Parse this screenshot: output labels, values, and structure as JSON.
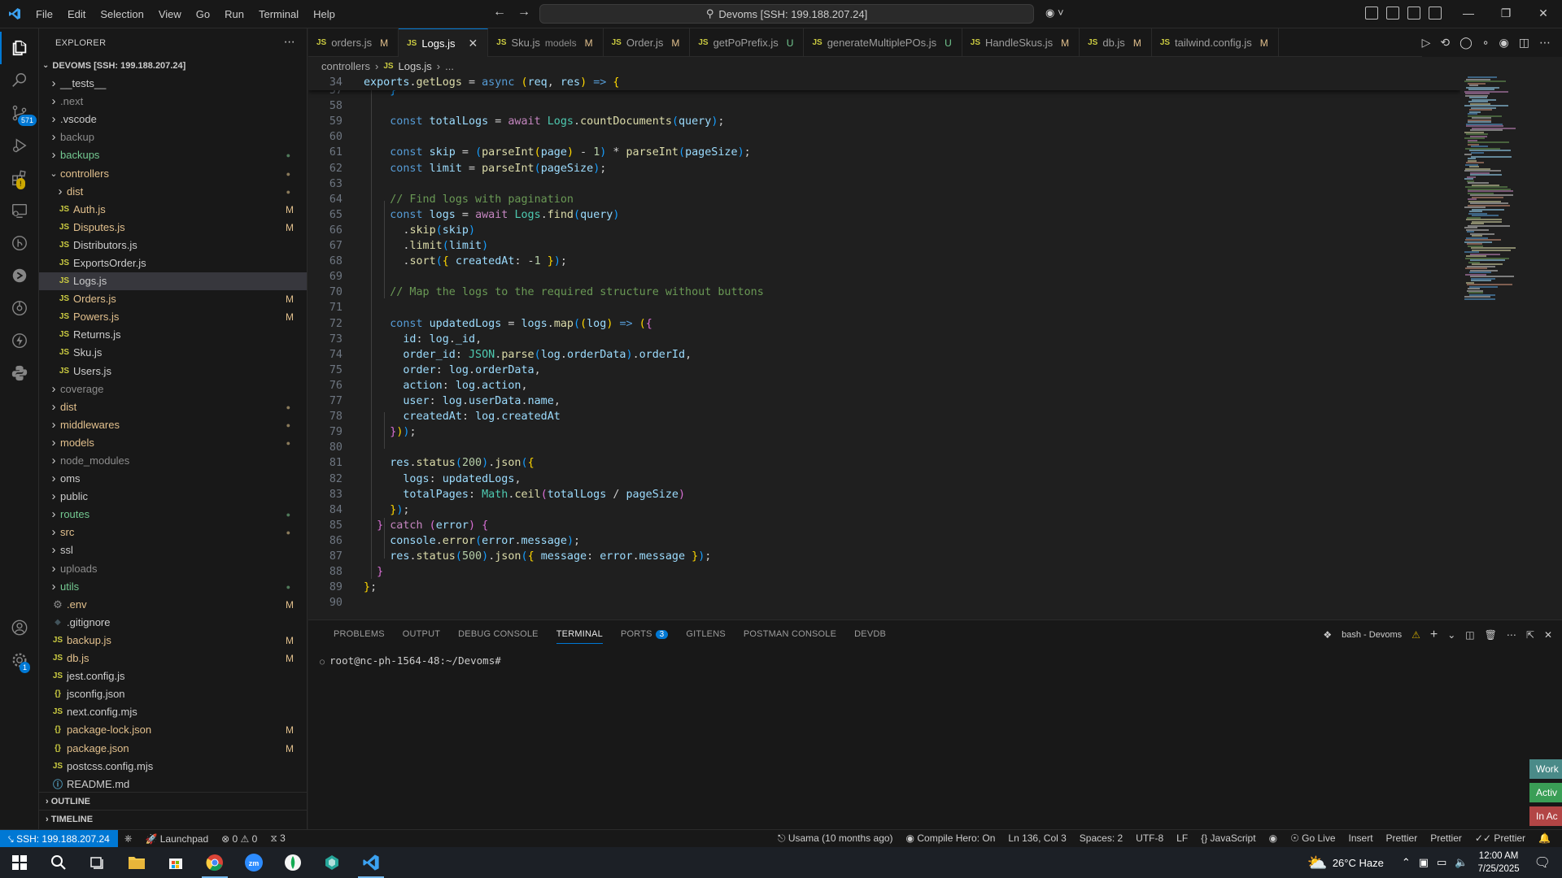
{
  "titlebar": {
    "menu": [
      "File",
      "Edit",
      "Selection",
      "View",
      "Go",
      "Run",
      "Terminal",
      "Help"
    ],
    "search_text": "Devoms [SSH: 199.188.207.24]"
  },
  "activity": {
    "scm_badge": "571"
  },
  "explorer": {
    "title": "EXPLORER",
    "root_label": "DEVOMS [SSH: 199.188.207.24]",
    "items": [
      {
        "label": "__tests__",
        "kind": "folder",
        "indent": 0,
        "open": false,
        "style": "",
        "status": ""
      },
      {
        "label": ".next",
        "kind": "folder",
        "indent": 0,
        "open": false,
        "style": "dim",
        "status": ""
      },
      {
        "label": ".vscode",
        "kind": "folder",
        "indent": 0,
        "open": false,
        "style": "",
        "status": ""
      },
      {
        "label": "backup",
        "kind": "folder",
        "indent": 0,
        "open": false,
        "style": "dim",
        "status": ""
      },
      {
        "label": "backups",
        "kind": "folder",
        "indent": 0,
        "open": false,
        "style": "green",
        "status": "dot-green"
      },
      {
        "label": "controllers",
        "kind": "folder",
        "indent": 0,
        "open": true,
        "style": "mod",
        "status": "dot"
      },
      {
        "label": "dist",
        "kind": "folder",
        "indent": 1,
        "open": false,
        "style": "mod",
        "status": "dot"
      },
      {
        "label": "Auth.js",
        "kind": "js",
        "indent": 1,
        "style": "mod",
        "status": "M"
      },
      {
        "label": "Disputes.js",
        "kind": "js",
        "indent": 1,
        "style": "mod",
        "status": "M"
      },
      {
        "label": "Distributors.js",
        "kind": "js",
        "indent": 1,
        "style": "",
        "status": ""
      },
      {
        "label": "ExportsOrder.js",
        "kind": "js",
        "indent": 1,
        "style": "",
        "status": ""
      },
      {
        "label": "Logs.js",
        "kind": "js",
        "indent": 1,
        "style": "",
        "status": "",
        "selected": true
      },
      {
        "label": "Orders.js",
        "kind": "js",
        "indent": 1,
        "style": "mod",
        "status": "M"
      },
      {
        "label": "Powers.js",
        "kind": "js",
        "indent": 1,
        "style": "mod",
        "status": "M"
      },
      {
        "label": "Returns.js",
        "kind": "js",
        "indent": 1,
        "style": "",
        "status": ""
      },
      {
        "label": "Sku.js",
        "kind": "js",
        "indent": 1,
        "style": "",
        "status": ""
      },
      {
        "label": "Users.js",
        "kind": "js",
        "indent": 1,
        "style": "",
        "status": ""
      },
      {
        "label": "coverage",
        "kind": "folder",
        "indent": 0,
        "open": false,
        "style": "dim",
        "status": ""
      },
      {
        "label": "dist",
        "kind": "folder",
        "indent": 0,
        "open": false,
        "style": "mod",
        "status": "dot"
      },
      {
        "label": "middlewares",
        "kind": "folder",
        "indent": 0,
        "open": false,
        "style": "mod",
        "status": "dot"
      },
      {
        "label": "models",
        "kind": "folder",
        "indent": 0,
        "open": false,
        "style": "mod",
        "status": "dot"
      },
      {
        "label": "node_modules",
        "kind": "folder",
        "indent": 0,
        "open": false,
        "style": "dim",
        "status": ""
      },
      {
        "label": "oms",
        "kind": "folder",
        "indent": 0,
        "open": false,
        "style": "",
        "status": ""
      },
      {
        "label": "public",
        "kind": "folder",
        "indent": 0,
        "open": false,
        "style": "",
        "status": ""
      },
      {
        "label": "routes",
        "kind": "folder",
        "indent": 0,
        "open": false,
        "style": "green",
        "status": "dot-green"
      },
      {
        "label": "src",
        "kind": "folder",
        "indent": 0,
        "open": false,
        "style": "mod",
        "status": "dot"
      },
      {
        "label": "ssl",
        "kind": "folder",
        "indent": 0,
        "open": false,
        "style": "",
        "status": ""
      },
      {
        "label": "uploads",
        "kind": "folder",
        "indent": 0,
        "open": false,
        "style": "dim",
        "status": ""
      },
      {
        "label": "utils",
        "kind": "folder",
        "indent": 0,
        "open": false,
        "style": "green",
        "status": "dot-green"
      },
      {
        "label": ".env",
        "kind": "gear",
        "indent": 0,
        "style": "mod",
        "status": "M"
      },
      {
        "label": ".gitignore",
        "kind": "git",
        "indent": 0,
        "style": "",
        "status": ""
      },
      {
        "label": "backup.js",
        "kind": "js",
        "indent": 0,
        "style": "mod",
        "status": "M"
      },
      {
        "label": "db.js",
        "kind": "js",
        "indent": 0,
        "style": "mod",
        "status": "M"
      },
      {
        "label": "jest.config.js",
        "kind": "js",
        "indent": 0,
        "style": "",
        "status": ""
      },
      {
        "label": "jsconfig.json",
        "kind": "json",
        "indent": 0,
        "style": "",
        "status": ""
      },
      {
        "label": "next.config.mjs",
        "kind": "js",
        "indent": 0,
        "style": "",
        "status": ""
      },
      {
        "label": "package-lock.json",
        "kind": "json",
        "indent": 0,
        "style": "mod",
        "status": "M"
      },
      {
        "label": "package.json",
        "kind": "json",
        "indent": 0,
        "style": "mod",
        "status": "M"
      },
      {
        "label": "postcss.config.mjs",
        "kind": "js",
        "indent": 0,
        "style": "",
        "status": ""
      },
      {
        "label": "README.md",
        "kind": "info",
        "indent": 0,
        "style": "",
        "status": ""
      }
    ],
    "outline_label": "OUTLINE",
    "timeline_label": "TIMELINE"
  },
  "tabs": [
    {
      "label": "orders.js",
      "desc": "",
      "status": "M",
      "active": false
    },
    {
      "label": "Logs.js",
      "desc": "",
      "status": "",
      "active": true
    },
    {
      "label": "Sku.js",
      "desc": "models",
      "status": "M",
      "active": false
    },
    {
      "label": "Order.js",
      "desc": "",
      "status": "M",
      "active": false
    },
    {
      "label": "getPoPrefix.js",
      "desc": "",
      "status": "U",
      "active": false
    },
    {
      "label": "generateMultiplePOs.js",
      "desc": "",
      "status": "U",
      "active": false
    },
    {
      "label": "HandleSkus.js",
      "desc": "",
      "status": "M",
      "active": false
    },
    {
      "label": "db.js",
      "desc": "",
      "status": "M",
      "active": false
    },
    {
      "label": "tailwind.config.js",
      "desc": "",
      "status": "M",
      "active": false
    }
  ],
  "breadcrumb": [
    "controllers",
    "Logs.js",
    "..."
  ],
  "editor": {
    "sticky": {
      "ln": "34",
      "html": "<span class='var'>exports</span>.<span class='fn'>getLogs</span> = <span class='kw'>async</span> <span class='br1'>(</span><span class='var'>req</span>, <span class='var'>res</span><span class='br1'>)</span> <span class='kw'>=&gt;</span> <span class='br1'>{</span>"
    },
    "lines": [
      {
        "ln": "57",
        "html": "    <span class='br3'>}</span>"
      },
      {
        "ln": "58",
        "html": ""
      },
      {
        "ln": "59",
        "html": "    <span class='kw'>const</span> <span class='var'>totalLogs</span> = <span class='kw2'>await</span> <span class='cls'>Logs</span>.<span class='fn'>countDocuments</span><span class='br3'>(</span><span class='var'>query</span><span class='br3'>)</span>;"
      },
      {
        "ln": "60",
        "html": ""
      },
      {
        "ln": "61",
        "html": "    <span class='kw'>const</span> <span class='var'>skip</span> = <span class='br3'>(</span><span class='fn'>parseInt</span><span class='br1'>(</span><span class='var'>page</span><span class='br1'>)</span> - <span class='num'>1</span><span class='br3'>)</span> * <span class='fn'>parseInt</span><span class='br3'>(</span><span class='var'>pageSize</span><span class='br3'>)</span>;"
      },
      {
        "ln": "62",
        "html": "    <span class='kw'>const</span> <span class='var'>limit</span> = <span class='fn'>parseInt</span><span class='br3'>(</span><span class='var'>pageSize</span><span class='br3'>)</span>;"
      },
      {
        "ln": "63",
        "html": ""
      },
      {
        "ln": "64",
        "html": "    <span class='cm'>// Find logs with pagination</span>"
      },
      {
        "ln": "65",
        "html": "    <span class='kw'>const</span> <span class='var'>logs</span> = <span class='kw2'>await</span> <span class='cls'>Logs</span>.<span class='fn'>find</span><span class='br3'>(</span><span class='var'>query</span><span class='br3'>)</span>"
      },
      {
        "ln": "66",
        "html": "      .<span class='fn'>skip</span><span class='br3'>(</span><span class='var'>skip</span><span class='br3'>)</span>"
      },
      {
        "ln": "67",
        "html": "      .<span class='fn'>limit</span><span class='br3'>(</span><span class='var'>limit</span><span class='br3'>)</span>"
      },
      {
        "ln": "68",
        "html": "      .<span class='fn'>sort</span><span class='br3'>(</span><span class='br1'>{</span> <span class='var'>createdAt</span>: -<span class='num'>1</span> <span class='br1'>}</span><span class='br3'>)</span>;"
      },
      {
        "ln": "69",
        "html": ""
      },
      {
        "ln": "70",
        "html": "    <span class='cm'>// Map the logs to the required structure without buttons</span>"
      },
      {
        "ln": "71",
        "html": ""
      },
      {
        "ln": "72",
        "html": "    <span class='kw'>const</span> <span class='var'>updatedLogs</span> = <span class='var'>logs</span>.<span class='fn'>map</span><span class='br3'>(</span><span class='br1'>(</span><span class='var'>log</span><span class='br1'>)</span> <span class='kw'>=&gt;</span> <span class='br1'>(</span><span class='br2'>{</span>"
      },
      {
        "ln": "73",
        "html": "      <span class='var'>id</span>: <span class='var'>log</span>.<span class='var'>_id</span>,"
      },
      {
        "ln": "74",
        "html": "      <span class='var'>order_id</span>: <span class='cls'>JSON</span>.<span class='fn'>parse</span><span class='br3'>(</span><span class='var'>log</span>.<span class='var'>orderData</span><span class='br3'>)</span>.<span class='var'>orderId</span>,"
      },
      {
        "ln": "75",
        "html": "      <span class='var'>order</span>: <span class='var'>log</span>.<span class='var'>orderData</span>,"
      },
      {
        "ln": "76",
        "html": "      <span class='var'>action</span>: <span class='var'>log</span>.<span class='var'>action</span>,"
      },
      {
        "ln": "77",
        "html": "      <span class='var'>user</span>: <span class='var'>log</span>.<span class='var'>userData</span>.<span class='var'>name</span>,"
      },
      {
        "ln": "78",
        "html": "      <span class='var'>createdAt</span>: <span class='var'>log</span>.<span class='var'>createdAt</span>"
      },
      {
        "ln": "79",
        "html": "    <span class='br2'>}</span><span class='br1'>)</span><span class='br3'>)</span>;"
      },
      {
        "ln": "80",
        "html": ""
      },
      {
        "ln": "81",
        "html": "    <span class='var'>res</span>.<span class='fn'>status</span><span class='br3'>(</span><span class='num'>200</span><span class='br3'>)</span>.<span class='fn'>json</span><span class='br3'>(</span><span class='br1'>{</span>"
      },
      {
        "ln": "82",
        "html": "      <span class='var'>logs</span>: <span class='var'>updatedLogs</span>,"
      },
      {
        "ln": "83",
        "html": "      <span class='var'>totalPages</span>: <span class='cls'>Math</span>.<span class='fn'>ceil</span><span class='br2'>(</span><span class='var'>totalLogs</span> / <span class='var'>pageSize</span><span class='br2'>)</span>"
      },
      {
        "ln": "84",
        "html": "    <span class='br1'>}</span><span class='br3'>)</span>;"
      },
      {
        "ln": "85",
        "html": "  <span class='br2'>}</span> <span class='kw2'>catch</span> <span class='br2'>(</span><span class='var'>error</span><span class='br2'>)</span> <span class='br2'>{</span>"
      },
      {
        "ln": "86",
        "html": "    <span class='var'>console</span>.<span class='fn'>error</span><span class='br3'>(</span><span class='var'>error</span>.<span class='var'>message</span><span class='br3'>)</span>;"
      },
      {
        "ln": "87",
        "html": "    <span class='var'>res</span>.<span class='fn'>status</span><span class='br3'>(</span><span class='num'>500</span><span class='br3'>)</span>.<span class='fn'>json</span><span class='br3'>(</span><span class='br1'>{</span> <span class='var'>message</span>: <span class='var'>error</span>.<span class='var'>message</span> <span class='br1'>}</span><span class='br3'>)</span>;"
      },
      {
        "ln": "88",
        "html": "  <span class='br2'>}</span>"
      },
      {
        "ln": "89",
        "html": "<span class='br1'>}</span>;"
      },
      {
        "ln": "90",
        "html": ""
      }
    ]
  },
  "panel": {
    "tabs": [
      {
        "label": "PROBLEMS",
        "active": false
      },
      {
        "label": "OUTPUT",
        "active": false
      },
      {
        "label": "DEBUG CONSOLE",
        "active": false
      },
      {
        "label": "TERMINAL",
        "active": true
      },
      {
        "label": "PORTS",
        "active": false,
        "badge": "3"
      },
      {
        "label": "GITLENS",
        "active": false
      },
      {
        "label": "POSTMAN CONSOLE",
        "active": false
      },
      {
        "label": "DEVDB",
        "active": false
      }
    ],
    "terminal_name": "bash - Devoms",
    "prompt": "root@nc-ph-1564-48:~/Devoms#"
  },
  "notifications": [
    "Work",
    "Activ",
    "In Ac"
  ],
  "statusbar": {
    "remote": "SSH: 199.188.207.24",
    "launchpad": "Launchpad",
    "errors": "0",
    "warnings": "0",
    "ports": "3",
    "blame": "Usama (10 months ago)",
    "compile_hero": "Compile Hero: On",
    "position": "Ln 136, Col 3",
    "spaces": "Spaces: 2",
    "encoding": "UTF-8",
    "eol": "LF",
    "language": "JavaScript",
    "golive": "Go Live",
    "insert": "Insert",
    "prettier1": "Prettier",
    "prettier2": "Prettier",
    "prettier3": "Prettier"
  },
  "taskbar": {
    "weather": "26°C  Haze",
    "time": "12:00 AM",
    "date": "7/25/2025"
  },
  "colors": {
    "accent": "#0078d4",
    "modified": "#e2c08d",
    "untracked": "#73c991"
  }
}
